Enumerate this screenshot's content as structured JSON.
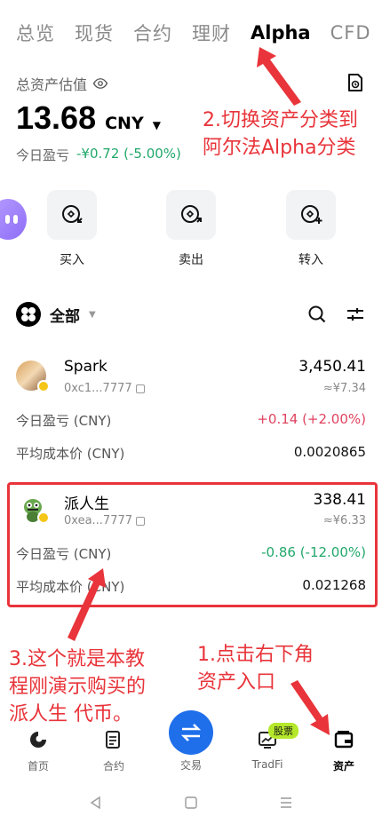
{
  "tabs": [
    "总览",
    "现货",
    "合约",
    "理财",
    "Alpha",
    "CFD"
  ],
  "active_tab": "Alpha",
  "asset": {
    "label": "总资产估值",
    "balance": "13.68",
    "currency": "CNY",
    "pnl_label": "今日盈亏",
    "pnl_value": "-¥0.72 (-5.00%)"
  },
  "actions": [
    {
      "label": "买入",
      "icon": "buy-coin-icon"
    },
    {
      "label": "卖出",
      "icon": "sell-coin-icon"
    },
    {
      "label": "转入",
      "icon": "transfer-in-icon"
    }
  ],
  "filter": {
    "label": "全部"
  },
  "tokens": [
    {
      "name": "Spark",
      "address": "0xc1...7777",
      "amount": "3,450.41",
      "value": "≈¥7.34",
      "pnl_label": "今日盈亏 (CNY)",
      "pnl_value": "+0.14 (+2.00%)",
      "cost_label": "平均成本价 (CNY)",
      "cost_value": "0.0020865"
    },
    {
      "name": "派人生",
      "address": "0xea...7777",
      "amount": "338.41",
      "value": "≈¥6.33",
      "pnl_label": "今日盈亏 (CNY)",
      "pnl_value": "-0.86 (-12.00%)",
      "cost_label": "平均成本价 (CNY)",
      "cost_value": "0.021268"
    }
  ],
  "annotations": {
    "a2_line1": "2.切换资产分类到",
    "a2_line2": "阿尔法Alpha分类",
    "a3_line1": "3.这个就是本教",
    "a3_line2": "程刚演示购买的",
    "a3_line3": "派人生 代币。",
    "a1_line1": "1.点击右下角",
    "a1_line2": "资产入口"
  },
  "nav": [
    {
      "label": "首页",
      "icon": "home-icon"
    },
    {
      "label": "合约",
      "icon": "contract-icon"
    },
    {
      "label": "交易",
      "icon": "trade-swap-icon"
    },
    {
      "label": "TradFi",
      "icon": "tradfi-chart-icon",
      "badge": "股票"
    },
    {
      "label": "资产",
      "icon": "wallet-icon"
    }
  ],
  "colors": {
    "accent": "#1f6feb",
    "annotation": "#e8343a",
    "gain": "#21a86b",
    "loss": "#e0435f"
  }
}
